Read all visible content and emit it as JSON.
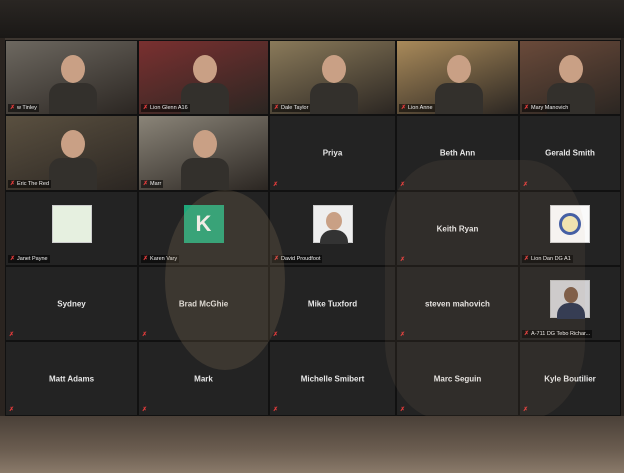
{
  "participants": [
    {
      "id": "p1",
      "name": "w Tinley",
      "kind": "video",
      "bg": "#6d6860"
    },
    {
      "id": "p2",
      "name": "Lion Glenn A16",
      "kind": "video",
      "bg": "#7a3030"
    },
    {
      "id": "p3",
      "name": "Dale Taylor",
      "kind": "video",
      "bg": "#8a7a5a"
    },
    {
      "id": "p4",
      "name": "Lion Anne",
      "kind": "video",
      "bg": "#a98a5a"
    },
    {
      "id": "p5",
      "name": "Mary Manovich",
      "kind": "video",
      "bg": "#6a4a3a"
    },
    {
      "id": "p6",
      "name": "Eric The Red",
      "kind": "video",
      "bg": "#5a5040"
    },
    {
      "id": "p7",
      "name": "Marr",
      "kind": "video",
      "bg": "#8a8478"
    },
    {
      "id": "p8",
      "name": "Priya",
      "kind": "name"
    },
    {
      "id": "p9",
      "name": "Beth Ann",
      "kind": "name"
    },
    {
      "id": "p10",
      "name": "Gerald Smith",
      "kind": "name"
    },
    {
      "id": "p11",
      "name": "Janet Payne",
      "kind": "avatar",
      "avatar": "bench"
    },
    {
      "id": "p12",
      "name": "Karen Vary",
      "kind": "avatar",
      "avatar": "letter",
      "letter": "K"
    },
    {
      "id": "p13",
      "name": "David Proudfoot",
      "kind": "avatar",
      "avatar": "glasses"
    },
    {
      "id": "p14",
      "name": "Keith Ryan",
      "kind": "name"
    },
    {
      "id": "p15",
      "name": "Lion Dan   DG A1",
      "kind": "avatar",
      "avatar": "dg"
    },
    {
      "id": "p16",
      "name": "Sydney",
      "kind": "name"
    },
    {
      "id": "p17",
      "name": "Brad McGhie",
      "kind": "name"
    },
    {
      "id": "p18",
      "name": "Mike Tuxford",
      "kind": "name"
    },
    {
      "id": "p19",
      "name": "steven mahovich",
      "kind": "name"
    },
    {
      "id": "p20",
      "name": "A-711 DG Tebo Richar...",
      "kind": "avatar",
      "avatar": "uniform"
    },
    {
      "id": "p21",
      "name": "Matt Adams",
      "kind": "name"
    },
    {
      "id": "p22",
      "name": "Mark",
      "kind": "name"
    },
    {
      "id": "p23",
      "name": "Michelle Smibert",
      "kind": "name"
    },
    {
      "id": "p24",
      "name": "Marc Seguin",
      "kind": "name"
    },
    {
      "id": "p25",
      "name": "Kyle Boutilier",
      "kind": "name"
    }
  ],
  "colors": {
    "muted_icon": "#e23b3b",
    "tile_bg": "#232323",
    "k_avatar": "#1fa77a"
  },
  "icons": {
    "muted": "microphone-muted-icon"
  }
}
